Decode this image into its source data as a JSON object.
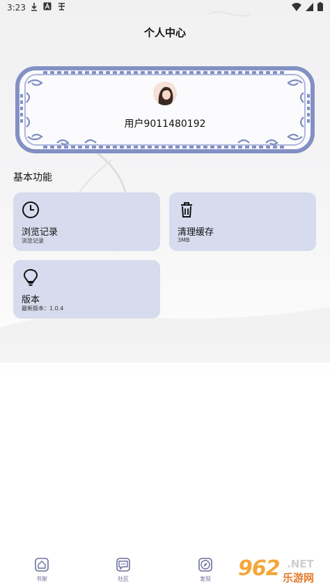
{
  "status_bar": {
    "time": "3:23",
    "left_icons": [
      "download-icon",
      "a-icon",
      "notification-icon"
    ],
    "right_icons": [
      "wifi-icon",
      "signal-icon",
      "battery-icon"
    ]
  },
  "header": {
    "title": "个人中心"
  },
  "profile": {
    "username": "用户9011480192"
  },
  "section": {
    "title": "基本功能"
  },
  "features": [
    {
      "label": "浏览记录",
      "sub": "浏览记录",
      "icon": "clock-icon"
    },
    {
      "label": "清理缓存",
      "sub": "3MB",
      "icon": "trash-icon"
    },
    {
      "label": "版本",
      "sub": "最新版本：1.0.4",
      "icon": "lightbulb-icon"
    }
  ],
  "tab_bar": {
    "tabs": [
      {
        "label": "书架",
        "icon": "home-icon"
      },
      {
        "label": "社区",
        "icon": "chat-icon"
      },
      {
        "label": "发现",
        "icon": "compass-icon"
      }
    ]
  },
  "watermark": {
    "brand": "962",
    "net": ".NET",
    "site": "乐游网"
  },
  "colors": {
    "card": "#d6dbed",
    "frame": "#7f8cc0",
    "accent": "#6b6f9a"
  }
}
